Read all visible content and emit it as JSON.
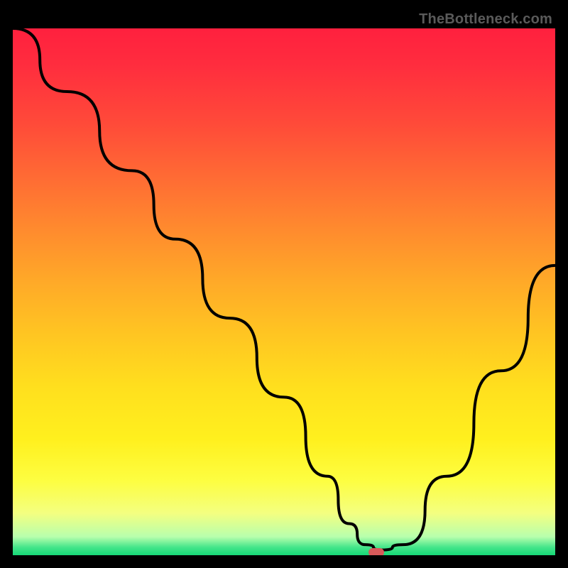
{
  "watermark": "TheBottleneck.com",
  "chart_data": {
    "type": "line",
    "title": "",
    "xlabel": "",
    "ylabel": "",
    "xlim": [
      0,
      100
    ],
    "ylim": [
      0,
      100
    ],
    "grid": false,
    "legend": false,
    "series": [
      {
        "name": "curve",
        "x": [
          0,
          10,
          22,
          30,
          40,
          50,
          58,
          62,
          65,
          68,
          72,
          80,
          90,
          100
        ],
        "y": [
          100,
          88,
          73,
          60,
          45,
          30,
          15,
          6,
          2,
          1,
          2,
          15,
          35,
          55
        ]
      }
    ],
    "marker": {
      "x": 67,
      "y": 0.5
    },
    "gradient_stops": [
      {
        "pct": 0,
        "color": "#ff203e"
      },
      {
        "pct": 50,
        "color": "#ffb426"
      },
      {
        "pct": 85,
        "color": "#fdfd3a"
      },
      {
        "pct": 100,
        "color": "#16d977"
      }
    ]
  }
}
